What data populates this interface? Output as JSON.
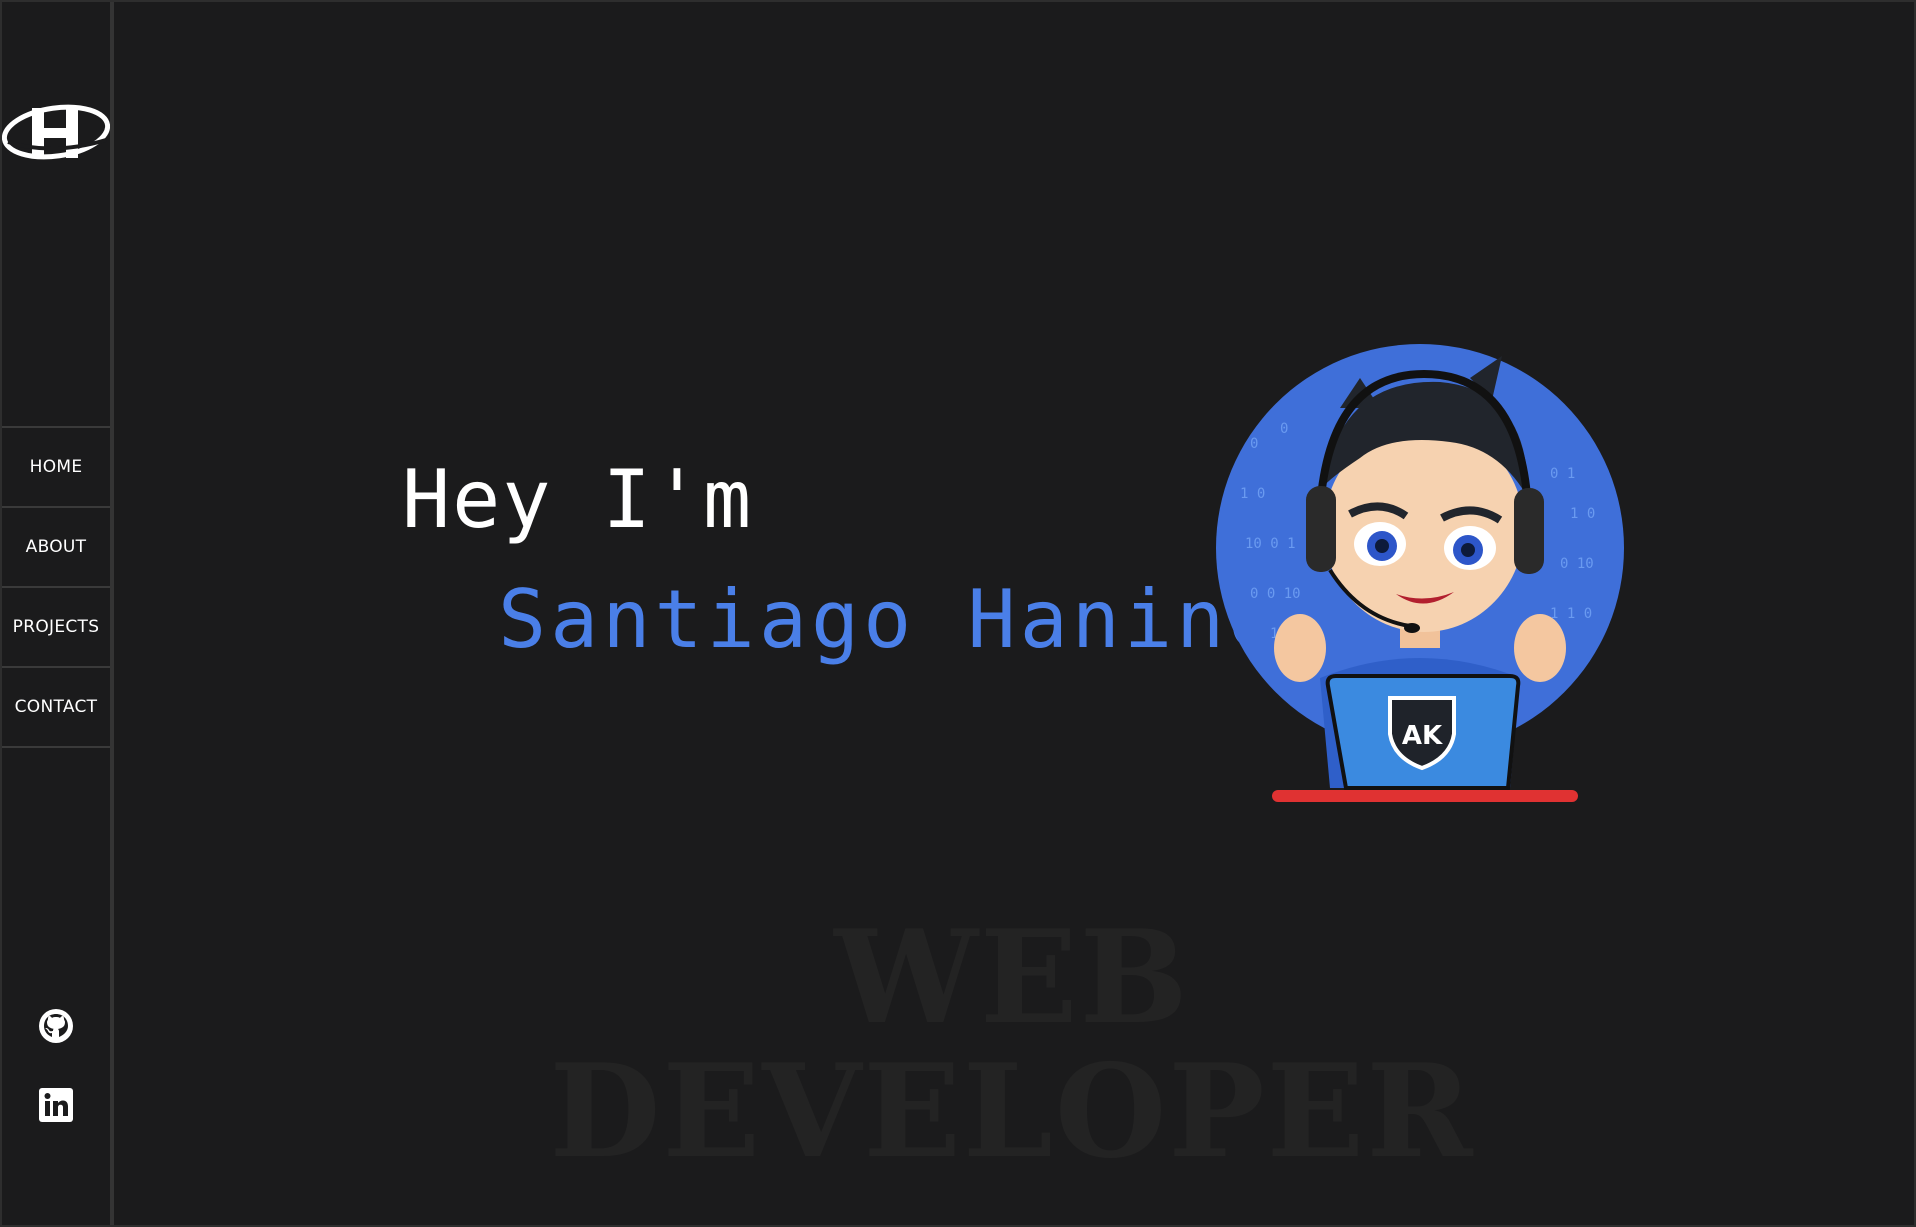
{
  "sidebar": {
    "logo_icon": "sh-logo-icon",
    "nav": [
      {
        "label": "HOME"
      },
      {
        "label": "ABOUT"
      },
      {
        "label": "PROJECTS"
      },
      {
        "label": "CONTACT"
      }
    ],
    "social": [
      {
        "icon": "github-icon"
      },
      {
        "icon": "linkedin-icon"
      }
    ]
  },
  "hero": {
    "greeting": "Hey I'm",
    "name": "Santiago Hanine",
    "name_color": "#4a7fe8",
    "avatar_badge": "AK"
  },
  "watermark": {
    "line1": "WEB",
    "line2": "DEVELOPER"
  },
  "colors": {
    "background": "#1b1b1c",
    "accent": "#4a7fe8",
    "text": "#ffffff"
  }
}
